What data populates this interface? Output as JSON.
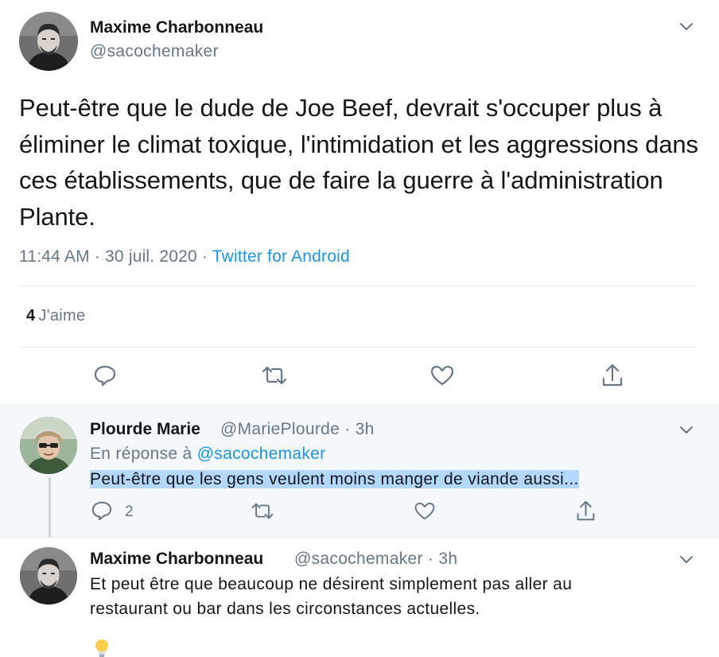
{
  "main_tweet": {
    "author_name": "Maxime Charbonneau",
    "author_handle": "@sacochemaker",
    "text": "Peut-être que le dude de Joe Beef, devrait s'occuper plus à éliminer le climat toxique, l'intimidation et les aggressions dans ces établissements, que de faire la guerre à l'administration Plante.",
    "time": "11:44 AM · 30 juil. 2020 · ",
    "source": "Twitter for Android",
    "likes_count": "4",
    "likes_label": "J'aime"
  },
  "reply_1": {
    "author_name": "Plourde Marie",
    "author_handle": "@MariePlourde · 3h",
    "reply_to_label": "En réponse à ",
    "reply_to_handle": "@sacochemaker",
    "text": "Peut-être que les gens veulent moins manger de viande aussi...",
    "reply_count": "2"
  },
  "reply_2": {
    "author_name": "Maxime Charbonneau",
    "author_handle": "@sacochemaker · 3h",
    "text_line1": "Et peut être que beaucoup ne désirent simplement pas aller au",
    "text_line2": "restaurant ou bar dans les circonstances actuelles."
  },
  "icons": {
    "reply": "speech-bubble-icon",
    "retweet": "retweet-arrows-icon",
    "like": "heart-outline-icon",
    "share": "share-upload-icon",
    "more": "chevron-down-icon",
    "partial": "lightbulb-icon"
  },
  "colors": {
    "link": "#1b95e0",
    "secondary_text": "#657786",
    "highlight": "#b3d7fe",
    "reply_bg": "#f5f8fa"
  }
}
